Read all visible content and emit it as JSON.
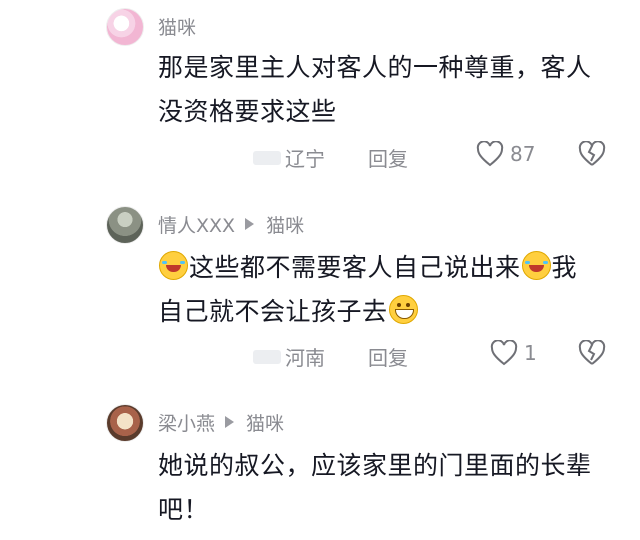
{
  "comments": [
    {
      "username": "猫咪",
      "text_line1": "那是家里主人对客人的一种尊重，客人",
      "text_line2": "没资格要求这些",
      "location": "辽宁",
      "reply_label": "回复",
      "like_count": "87",
      "avatar_icon": "avatar-image"
    },
    {
      "username": "情人XXX",
      "reply_to": "猫咪",
      "text_parts": [
        "这些都不需要客人自己说出来",
        "我",
        "自己就不会让孩子去"
      ],
      "emojis": [
        "laughing-crying-emoji",
        "grinning-emoji"
      ],
      "location": "河南",
      "reply_label": "回复",
      "like_count": "1",
      "avatar_icon": "avatar-image"
    },
    {
      "username": "梁小燕",
      "reply_to": "猫咪",
      "text_line1": "她说的叔公，应该家里的门里面的长辈",
      "text_line2": "吧！",
      "avatar_icon": "avatar-image"
    }
  ],
  "colors": {
    "secondary_text": "#8a8b91",
    "primary_text": "#161823"
  }
}
